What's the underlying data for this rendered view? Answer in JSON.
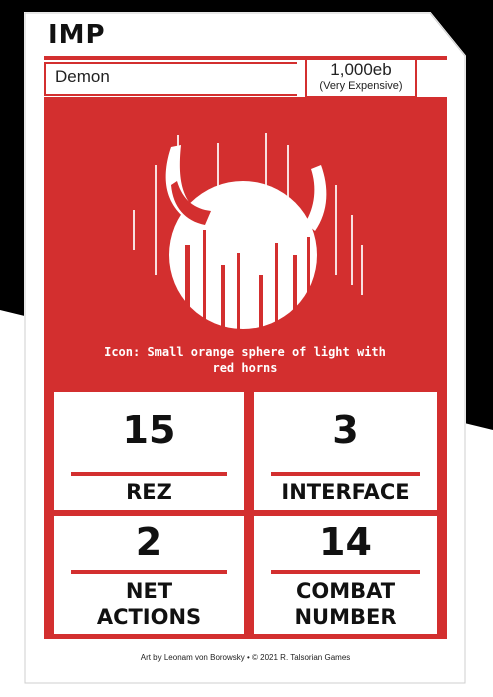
{
  "card": {
    "name": "IMP",
    "type": "Demon",
    "cost": "1,000eb",
    "cost_note": "(Very Expensive)",
    "icon_caption": "Icon: Small orange sphere of light with red horns",
    "credits": "Art by Leonam von Borowsky • © 2021 R. Talsorian Games"
  },
  "stats": {
    "rez": {
      "value": "15",
      "label": "REZ"
    },
    "interface": {
      "value": "3",
      "label": "INTERFACE"
    },
    "net_actions": {
      "value": "2",
      "label_line1": "NET",
      "label_line2": "ACTIONS"
    },
    "combat_number": {
      "value": "14",
      "label_line1": "COMBAT",
      "label_line2": "NUMBER"
    }
  },
  "colors": {
    "accent": "#d32f2f",
    "background": "#000000",
    "card": "#ffffff"
  }
}
